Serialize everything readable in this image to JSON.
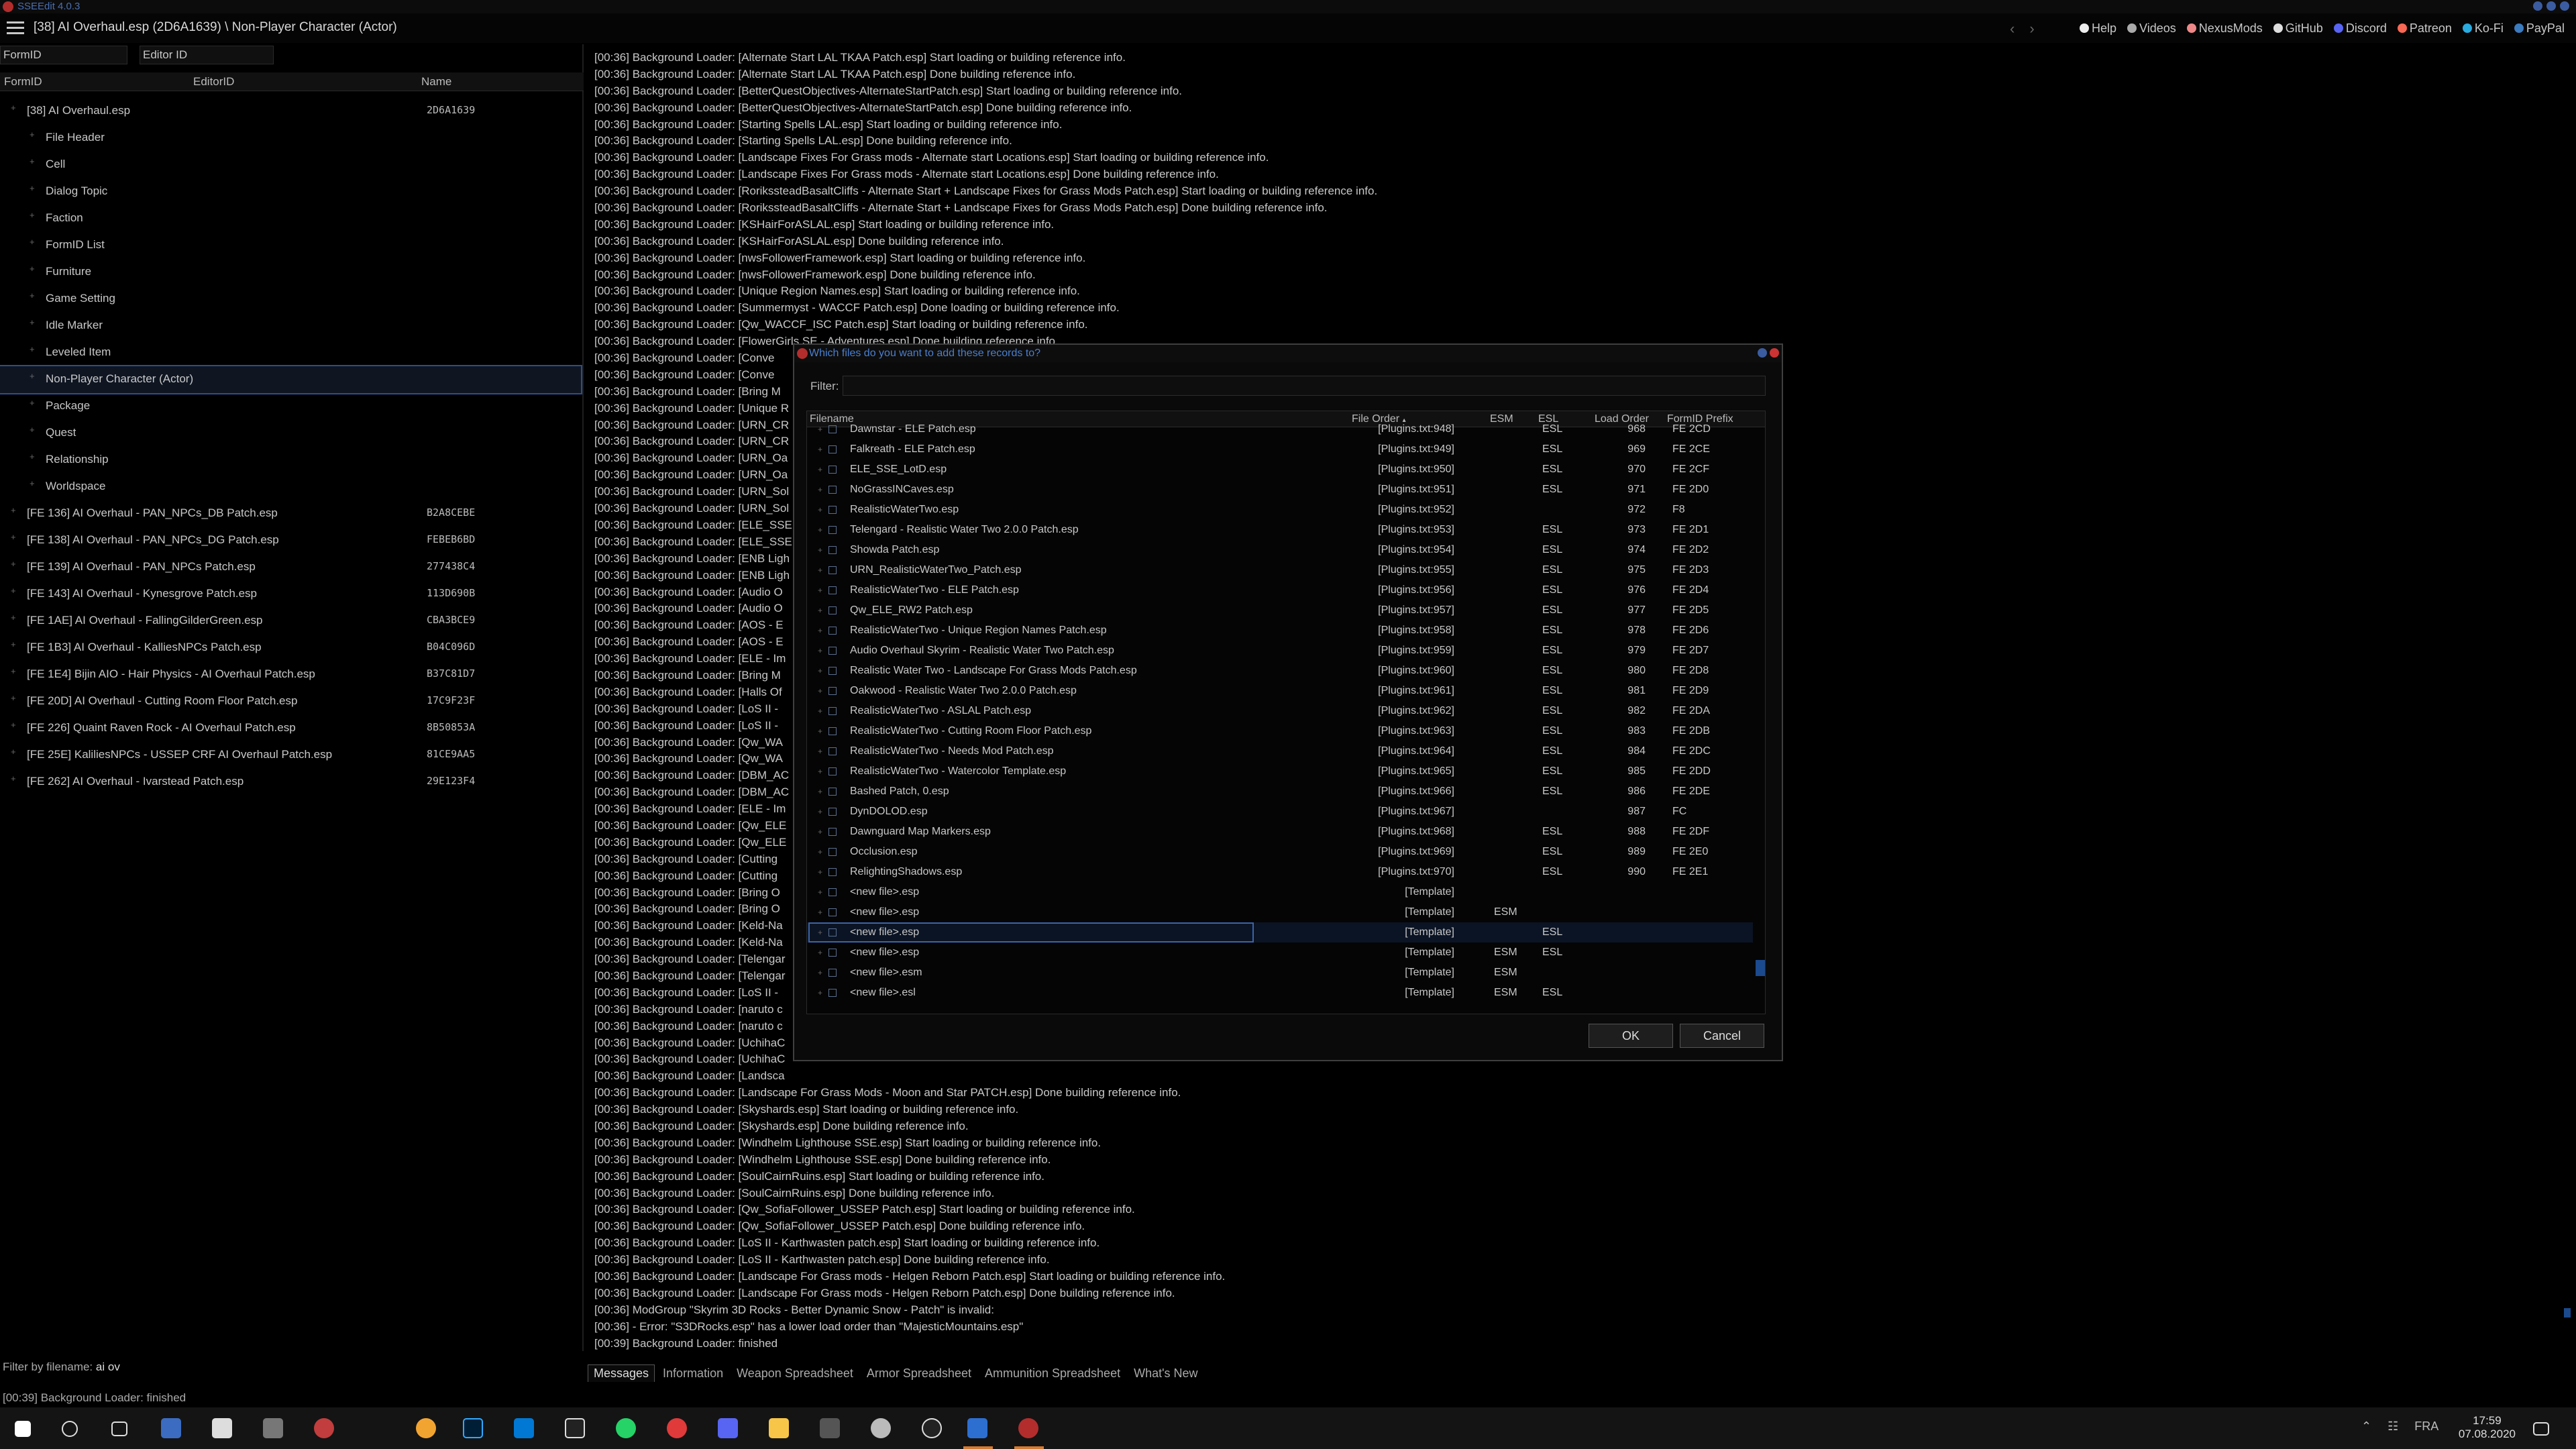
{
  "window": {
    "title": "SSEEdit 4.0.3",
    "path": "[38] AI Overhaul.esp (2D6A1639) \\ Non-Player Character (Actor)"
  },
  "top_links": [
    "Help",
    "Videos",
    "NexusMods",
    "GitHub",
    "Discord",
    "Patreon",
    "Ko-Fi",
    "PayPal"
  ],
  "left": {
    "formid_filter": "FormID",
    "editorid_filter": "Editor ID",
    "columns": [
      "FormID",
      "EditorID",
      "Name"
    ],
    "tree": [
      {
        "label": "[38] AI Overhaul.esp",
        "value": "2D6A1639",
        "level": 0
      },
      {
        "label": "File Header",
        "value": "",
        "level": 1
      },
      {
        "label": "Cell",
        "value": "",
        "level": 1
      },
      {
        "label": "Dialog Topic",
        "value": "",
        "level": 1
      },
      {
        "label": "Faction",
        "value": "",
        "level": 1
      },
      {
        "label": "FormID List",
        "value": "",
        "level": 1
      },
      {
        "label": "Furniture",
        "value": "",
        "level": 1
      },
      {
        "label": "Game Setting",
        "value": "",
        "level": 1
      },
      {
        "label": "Idle Marker",
        "value": "",
        "level": 1
      },
      {
        "label": "Leveled Item",
        "value": "",
        "level": 1
      },
      {
        "label": "Non-Player Character (Actor)",
        "value": "",
        "level": 1,
        "selected": true
      },
      {
        "label": "Package",
        "value": "",
        "level": 1
      },
      {
        "label": "Quest",
        "value": "",
        "level": 1
      },
      {
        "label": "Relationship",
        "value": "",
        "level": 1
      },
      {
        "label": "Worldspace",
        "value": "",
        "level": 1
      },
      {
        "label": "[FE 136] AI Overhaul - PAN_NPCs_DB Patch.esp",
        "value": "B2A8CEBE",
        "level": 0
      },
      {
        "label": "[FE 138] AI Overhaul - PAN_NPCs_DG Patch.esp",
        "value": "FEBEB6BD",
        "level": 0
      },
      {
        "label": "[FE 139] AI Overhaul - PAN_NPCs Patch.esp",
        "value": "277438C4",
        "level": 0
      },
      {
        "label": "[FE 143] AI Overhaul - Kynesgrove Patch.esp",
        "value": "113D690B",
        "level": 0
      },
      {
        "label": "[FE 1AE] AI Overhaul - FallingGilderGreen.esp",
        "value": "CBA3BCE9",
        "level": 0
      },
      {
        "label": "[FE 1B3] AI Overhaul - KalliesNPCs Patch.esp",
        "value": "B04C096D",
        "level": 0
      },
      {
        "label": "[FE 1E4] Bijin AIO - Hair Physics - AI Overhaul Patch.esp",
        "value": "B37C81D7",
        "level": 0
      },
      {
        "label": "[FE 20D] AI Overhaul - Cutting Room Floor Patch.esp",
        "value": "17C9F23F",
        "level": 0
      },
      {
        "label": "[FE 226] Quaint Raven Rock - AI Overhaul Patch.esp",
        "value": "8B50853A",
        "level": 0
      },
      {
        "label": "[FE 25E] KaliliesNPCs - USSEP CRF AI Overhaul Patch.esp",
        "value": "81CE9AA5",
        "level": 0
      },
      {
        "label": "[FE 262] AI Overhaul - Ivarstead Patch.esp",
        "value": "29E123F4",
        "level": 0
      }
    ],
    "filter_label": "Filter by filename:",
    "filter_value": "ai ov"
  },
  "log": [
    "[00:36] Background Loader: [Alternate Start LAL TKAA Patch.esp] Start loading or building reference info.",
    "[00:36] Background Loader: [Alternate Start LAL TKAA Patch.esp] Done building reference info.",
    "[00:36] Background Loader: [BetterQuestObjectives-AlternateStartPatch.esp] Start loading or building reference info.",
    "[00:36] Background Loader: [BetterQuestObjectives-AlternateStartPatch.esp] Done building reference info.",
    "[00:36] Background Loader: [Starting Spells LAL.esp] Start loading or building reference info.",
    "[00:36] Background Loader: [Starting Spells LAL.esp] Done building reference info.",
    "[00:36] Background Loader: [Landscape Fixes For Grass mods - Alternate start Locations.esp] Start loading or building reference info.",
    "[00:36] Background Loader: [Landscape Fixes For Grass mods - Alternate start Locations.esp] Done building reference info.",
    "[00:36] Background Loader: [RorikssteadBasaltCliffs - Alternate Start + Landscape Fixes for Grass Mods Patch.esp] Start loading or building reference info.",
    "[00:36] Background Loader: [RorikssteadBasaltCliffs - Alternate Start + Landscape Fixes for Grass Mods Patch.esp] Done building reference info.",
    "[00:36] Background Loader: [KSHairForASLAL.esp] Start loading or building reference info.",
    "[00:36] Background Loader: [KSHairForASLAL.esp] Done building reference info.",
    "[00:36] Background Loader: [nwsFollowerFramework.esp] Start loading or building reference info.",
    "[00:36] Background Loader: [nwsFollowerFramework.esp] Done building reference info.",
    "[00:36] Background Loader: [Unique Region Names.esp] Start loading or building reference info.",
    "[00:36] Background Loader: [Summermyst - WACCF Patch.esp] Done loading or building reference info.",
    "[00:36] Background Loader: [Qw_WACCF_ISC Patch.esp] Start loading or building reference info.",
    "[00:36] Background Loader: [FlowerGirls SE - Adventures.esp] Done building reference info.",
    "[00:36] Background Loader: [Conve",
    "[00:36] Background Loader: [Conve",
    "[00:36] Background Loader: [Bring M",
    "[00:36] Background Loader: [Unique R",
    "[00:36] Background Loader: [URN_CR",
    "[00:36] Background Loader: [URN_CR",
    "[00:36] Background Loader: [URN_Oa",
    "[00:36] Background Loader: [URN_Oa",
    "[00:36] Background Loader: [URN_Sol",
    "[00:36] Background Loader: [URN_Sol",
    "[00:36] Background Loader: [ELE_SSE",
    "[00:36] Background Loader: [ELE_SSE",
    "[00:36] Background Loader: [ENB Ligh",
    "[00:36] Background Loader: [ENB Ligh",
    "[00:36] Background Loader: [Audio O",
    "[00:36] Background Loader: [Audio O",
    "[00:36] Background Loader: [AOS - E",
    "[00:36] Background Loader: [AOS - E",
    "[00:36] Background Loader: [ELE - Im",
    "[00:36] Background Loader: [Bring M",
    "[00:36] Background Loader: [Halls Of",
    "[00:36] Background Loader: [LoS II -",
    "[00:36] Background Loader: [LoS II -",
    "[00:36] Background Loader: [Qw_WA",
    "[00:36] Background Loader: [Qw_WA",
    "[00:36] Background Loader: [DBM_AC",
    "[00:36] Background Loader: [DBM_AC",
    "[00:36] Background Loader: [ELE - Im",
    "[00:36] Background Loader: [Qw_ELE",
    "[00:36] Background Loader: [Qw_ELE",
    "[00:36] Background Loader: [Cutting",
    "[00:36] Background Loader: [Cutting",
    "[00:36] Background Loader: [Bring O",
    "[00:36] Background Loader: [Bring O",
    "[00:36] Background Loader: [Keld-Na",
    "[00:36] Background Loader: [Keld-Na",
    "[00:36] Background Loader: [Telengar",
    "[00:36] Background Loader: [Telengar",
    "[00:36] Background Loader: [LoS II -",
    "[00:36] Background Loader: [naruto c",
    "[00:36] Background Loader: [naruto c",
    "[00:36] Background Loader: [UchihaC",
    "[00:36] Background Loader: [UchihaC",
    "[00:36] Background Loader: [Landsca",
    "[00:36] Background Loader: [Landscape For Grass Mods - Moon and Star PATCH.esp] Done building reference info.",
    "[00:36] Background Loader: [Skyshards.esp] Start loading or building reference info.",
    "[00:36] Background Loader: [Skyshards.esp] Done building reference info.",
    "[00:36] Background Loader: [Windhelm Lighthouse SSE.esp] Start loading or building reference info.",
    "[00:36] Background Loader: [Windhelm Lighthouse SSE.esp] Done building reference info.",
    "[00:36] Background Loader: [SoulCairnRuins.esp] Start loading or building reference info.",
    "[00:36] Background Loader: [SoulCairnRuins.esp] Done building reference info.",
    "[00:36] Background Loader: [Qw_SofiaFollower_USSEP Patch.esp] Start loading or building reference info.",
    "[00:36] Background Loader: [Qw_SofiaFollower_USSEP Patch.esp] Done building reference info.",
    "[00:36] Background Loader: [LoS II - Karthwasten patch.esp] Start loading or building reference info.",
    "[00:36] Background Loader: [LoS II - Karthwasten patch.esp] Done building reference info.",
    "[00:36] Background Loader: [Landscape For Grass mods - Helgen Reborn Patch.esp] Start loading or building reference info.",
    "[00:36] Background Loader: [Landscape For Grass mods - Helgen Reborn Patch.esp] Done building reference info.",
    "[00:36] ModGroup \"Skyrim 3D Rocks - Better Dynamic Snow - Patch\" is invalid:",
    "[00:36] - Error: \"S3DRocks.esp\" has a lower load order than \"MajesticMountains.esp\"",
    "[00:39] Background Loader: finished"
  ],
  "tabs": [
    "Messages",
    "Information",
    "Weapon Spreadsheet",
    "Armor Spreadsheet",
    "Ammunition Spreadsheet",
    "What's New"
  ],
  "status": "[00:39] Background Loader: finished",
  "dialog": {
    "title": "Which files do you want to add these records to?",
    "filter_label": "Filter:",
    "filter_value": "",
    "columns": [
      "Filename",
      "File Order",
      "ESM",
      "ESL",
      "Load Order",
      "FormID Prefix"
    ],
    "rows": [
      {
        "name": "Dawnstar - ELE Patch.esp",
        "order": "[Plugins.txt:948]",
        "esm": "",
        "esl": "ESL",
        "load": "968",
        "prefix": "FE 2CD"
      },
      {
        "name": "Falkreath - ELE Patch.esp",
        "order": "[Plugins.txt:949]",
        "esm": "",
        "esl": "ESL",
        "load": "969",
        "prefix": "FE 2CE"
      },
      {
        "name": "ELE_SSE_LotD.esp",
        "order": "[Plugins.txt:950]",
        "esm": "",
        "esl": "ESL",
        "load": "970",
        "prefix": "FE 2CF"
      },
      {
        "name": "NoGrassINCaves.esp",
        "order": "[Plugins.txt:951]",
        "esm": "",
        "esl": "ESL",
        "load": "971",
        "prefix": "FE 2D0"
      },
      {
        "name": "RealisticWaterTwo.esp",
        "order": "[Plugins.txt:952]",
        "esm": "",
        "esl": "",
        "load": "972",
        "prefix": "F8"
      },
      {
        "name": "Telengard - Realistic Water Two 2.0.0 Patch.esp",
        "order": "[Plugins.txt:953]",
        "esm": "",
        "esl": "ESL",
        "load": "973",
        "prefix": "FE 2D1"
      },
      {
        "name": "Showda Patch.esp",
        "order": "[Plugins.txt:954]",
        "esm": "",
        "esl": "ESL",
        "load": "974",
        "prefix": "FE 2D2"
      },
      {
        "name": "URN_RealisticWaterTwo_Patch.esp",
        "order": "[Plugins.txt:955]",
        "esm": "",
        "esl": "ESL",
        "load": "975",
        "prefix": "FE 2D3"
      },
      {
        "name": "RealisticWaterTwo - ELE Patch.esp",
        "order": "[Plugins.txt:956]",
        "esm": "",
        "esl": "ESL",
        "load": "976",
        "prefix": "FE 2D4"
      },
      {
        "name": "Qw_ELE_RW2 Patch.esp",
        "order": "[Plugins.txt:957]",
        "esm": "",
        "esl": "ESL",
        "load": "977",
        "prefix": "FE 2D5"
      },
      {
        "name": "RealisticWaterTwo - Unique Region Names Patch.esp",
        "order": "[Plugins.txt:958]",
        "esm": "",
        "esl": "ESL",
        "load": "978",
        "prefix": "FE 2D6"
      },
      {
        "name": "Audio Overhaul Skyrim - Realistic Water Two Patch.esp",
        "order": "[Plugins.txt:959]",
        "esm": "",
        "esl": "ESL",
        "load": "979",
        "prefix": "FE 2D7"
      },
      {
        "name": "Realistic Water Two - Landscape For Grass Mods Patch.esp",
        "order": "[Plugins.txt:960]",
        "esm": "",
        "esl": "ESL",
        "load": "980",
        "prefix": "FE 2D8"
      },
      {
        "name": "Oakwood - Realistic Water Two 2.0.0 Patch.esp",
        "order": "[Plugins.txt:961]",
        "esm": "",
        "esl": "ESL",
        "load": "981",
        "prefix": "FE 2D9"
      },
      {
        "name": "RealisticWaterTwo - ASLAL Patch.esp",
        "order": "[Plugins.txt:962]",
        "esm": "",
        "esl": "ESL",
        "load": "982",
        "prefix": "FE 2DA"
      },
      {
        "name": "RealisticWaterTwo - Cutting Room Floor Patch.esp",
        "order": "[Plugins.txt:963]",
        "esm": "",
        "esl": "ESL",
        "load": "983",
        "prefix": "FE 2DB"
      },
      {
        "name": "RealisticWaterTwo - Needs Mod Patch.esp",
        "order": "[Plugins.txt:964]",
        "esm": "",
        "esl": "ESL",
        "load": "984",
        "prefix": "FE 2DC"
      },
      {
        "name": "RealisticWaterTwo - Watercolor Template.esp",
        "order": "[Plugins.txt:965]",
        "esm": "",
        "esl": "ESL",
        "load": "985",
        "prefix": "FE 2DD"
      },
      {
        "name": "Bashed Patch, 0.esp",
        "order": "[Plugins.txt:966]",
        "esm": "",
        "esl": "ESL",
        "load": "986",
        "prefix": "FE 2DE"
      },
      {
        "name": "DynDOLOD.esp",
        "order": "[Plugins.txt:967]",
        "esm": "",
        "esl": "",
        "load": "987",
        "prefix": "FC"
      },
      {
        "name": "Dawnguard Map Markers.esp",
        "order": "[Plugins.txt:968]",
        "esm": "",
        "esl": "ESL",
        "load": "988",
        "prefix": "FE 2DF"
      },
      {
        "name": "Occlusion.esp",
        "order": "[Plugins.txt:969]",
        "esm": "",
        "esl": "ESL",
        "load": "989",
        "prefix": "FE 2E0"
      },
      {
        "name": "RelightingShadows.esp",
        "order": "[Plugins.txt:970]",
        "esm": "",
        "esl": "ESL",
        "load": "990",
        "prefix": "FE 2E1"
      },
      {
        "name": "<new file>.esp",
        "order": "[Template]",
        "esm": "",
        "esl": "",
        "load": "",
        "prefix": ""
      },
      {
        "name": "<new file>.esp",
        "order": "[Template]",
        "esm": "ESM",
        "esl": "",
        "load": "",
        "prefix": ""
      },
      {
        "name": "<new file>.esp",
        "order": "[Template]",
        "esm": "",
        "esl": "ESL",
        "load": "",
        "prefix": "",
        "selected": true
      },
      {
        "name": "<new file>.esp",
        "order": "[Template]",
        "esm": "ESM",
        "esl": "ESL",
        "load": "",
        "prefix": ""
      },
      {
        "name": "<new file>.esm",
        "order": "[Template]",
        "esm": "ESM",
        "esl": "",
        "load": "",
        "prefix": ""
      },
      {
        "name": "<new file>.esl",
        "order": "[Template]",
        "esm": "ESM",
        "esl": "ESL",
        "load": "",
        "prefix": ""
      }
    ],
    "ok_label": "OK",
    "cancel_label": "Cancel"
  },
  "taskbar": {
    "lang": "FRA",
    "time": "17:59",
    "date": "07.08.2020"
  },
  "colors": {
    "accent": "#2d4e8c",
    "dialog_title": "#4a7fd0",
    "taskbar_active": "#d47a33"
  }
}
